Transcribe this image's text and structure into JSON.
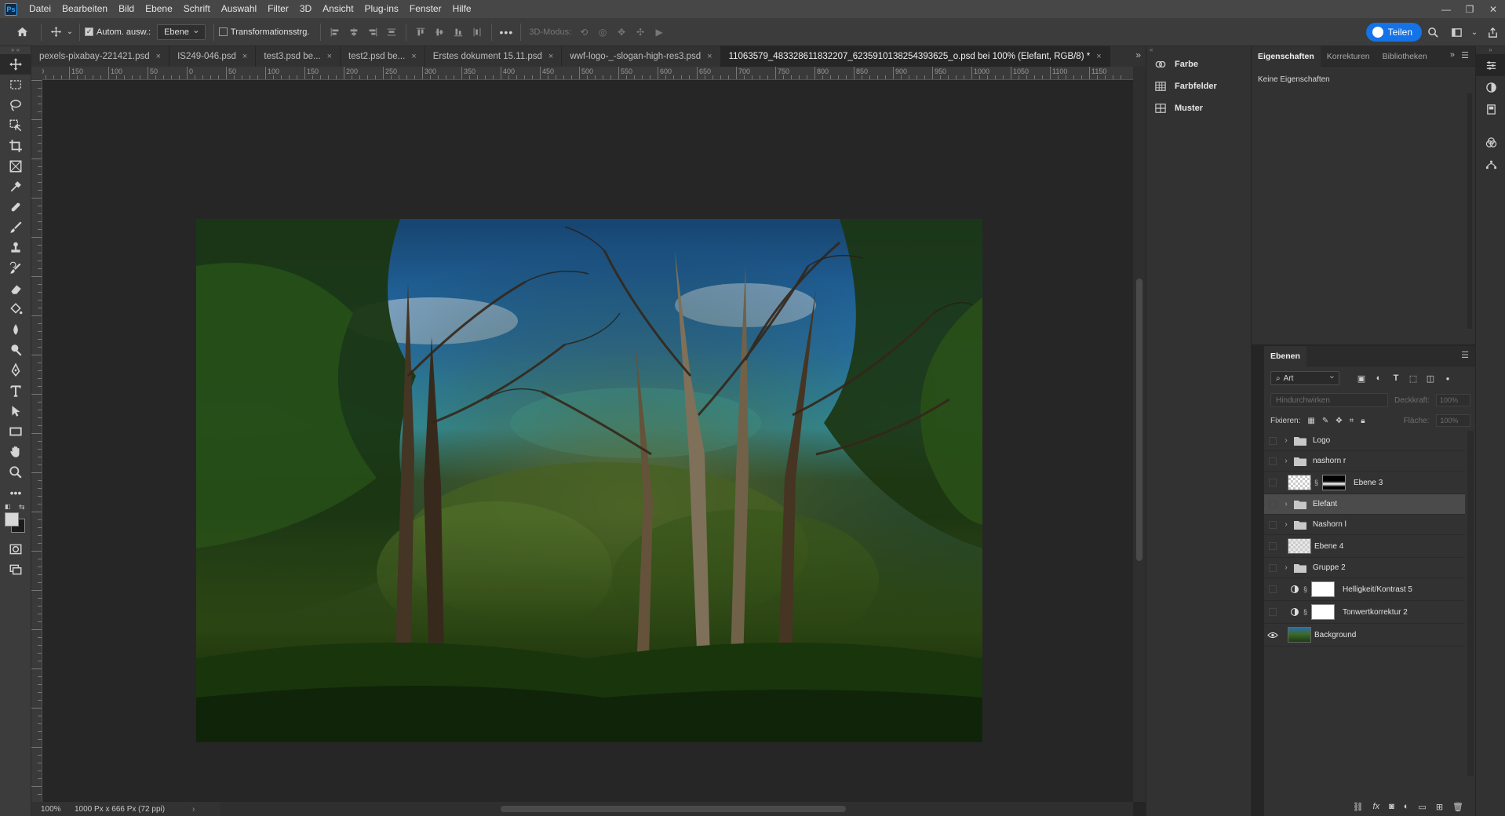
{
  "app": {
    "logo": "Ps"
  },
  "menu": {
    "items": [
      "Datei",
      "Bearbeiten",
      "Bild",
      "Ebene",
      "Schrift",
      "Auswahl",
      "Filter",
      "3D",
      "Ansicht",
      "Plug-ins",
      "Fenster",
      "Hilfe"
    ]
  },
  "window_controls": {
    "minimize": "—",
    "restore": "❐",
    "close": "✕"
  },
  "options": {
    "auto_select_label": "Autom. ausw.:",
    "auto_select_checked": true,
    "layer_select_value": "Ebene",
    "transform_label": "Transformationsstrg.",
    "transform_checked": false,
    "more": "•••",
    "mode_3d_label": "3D-Modus:",
    "share_label": "Teilen"
  },
  "tabs": [
    {
      "label": "pexels-pixabay-221421.psd",
      "active": false
    },
    {
      "label": "IS249-046.psd",
      "active": false
    },
    {
      "label": "test3.psd be...",
      "active": false
    },
    {
      "label": "test2.psd be...",
      "active": false
    },
    {
      "label": "Erstes dokument 15.11.psd",
      "active": false
    },
    {
      "label": "wwf-logo-_-slogan-high-res3.psd",
      "active": false
    },
    {
      "label": "11063579_483328611832207_6235910138254393625_o.psd bei 100% (Elefant, RGB/8) *",
      "active": true
    }
  ],
  "ruler": {
    "top_labels": [
      "100",
      "150",
      "100",
      "50",
      "0",
      "50",
      "100",
      "150",
      "200",
      "250",
      "300",
      "350",
      "400",
      "450",
      "500",
      "550",
      "600",
      "650",
      "700",
      "750",
      "800",
      "850",
      "900",
      "950",
      "1000",
      "1050",
      "1100",
      "1150"
    ]
  },
  "status": {
    "zoom": "100%",
    "doc_info": "1000 Px x 666 Px (72 ppi)",
    "arrow": "›"
  },
  "dock": {
    "items": [
      {
        "label": "Farbe",
        "icon": "color-wheel-icon"
      },
      {
        "label": "Farbfelder",
        "icon": "swatches-grid-icon"
      },
      {
        "label": "Muster",
        "icon": "pattern-grid-icon"
      }
    ]
  },
  "properties": {
    "tabs": [
      "Eigenschaften",
      "Korrekturen",
      "Bibliotheken"
    ],
    "active_tab": "Eigenschaften",
    "empty_text": "Keine Eigenschaften"
  },
  "layers": {
    "title": "Ebenen",
    "filter_value": "Art",
    "blend_mode": "Hindurchwirken",
    "opacity_label": "Deckkraft:",
    "opacity_value": "100%",
    "lock_label": "Fixieren:",
    "fill_label": "Fläche:",
    "fill_value": "100%",
    "items": [
      {
        "name": "Logo",
        "kind": "group",
        "visible": false,
        "selected": false
      },
      {
        "name": "nashorn r",
        "kind": "group",
        "visible": false,
        "selected": false
      },
      {
        "name": "Ebene 3",
        "kind": "masked",
        "visible": false,
        "selected": false
      },
      {
        "name": "Elefant",
        "kind": "group",
        "visible": false,
        "selected": true
      },
      {
        "name": "Nashorn l",
        "kind": "group",
        "visible": false,
        "selected": false
      },
      {
        "name": "Ebene 4",
        "kind": "pixel",
        "visible": false,
        "selected": false
      },
      {
        "name": "Gruppe 2",
        "kind": "group",
        "visible": false,
        "selected": false
      },
      {
        "name": "Helligkeit/Kontrast 5",
        "kind": "adjustment",
        "visible": false,
        "selected": false
      },
      {
        "name": "Tonwertkorrektur 2",
        "kind": "adjustment",
        "visible": false,
        "selected": false
      },
      {
        "name": "Background",
        "kind": "background",
        "visible": true,
        "selected": false
      }
    ],
    "footer_icons": [
      "link-icon",
      "fx-icon",
      "mask-icon",
      "adjustment-icon",
      "folder-icon",
      "new-layer-icon",
      "trash-icon"
    ]
  },
  "colors": {
    "accent": "#1473e6",
    "foreground_swatch": "#d8d8d8",
    "background_swatch": "#1b1b1b",
    "ui_dark": "#323232",
    "canvas_bg": "#262626"
  }
}
